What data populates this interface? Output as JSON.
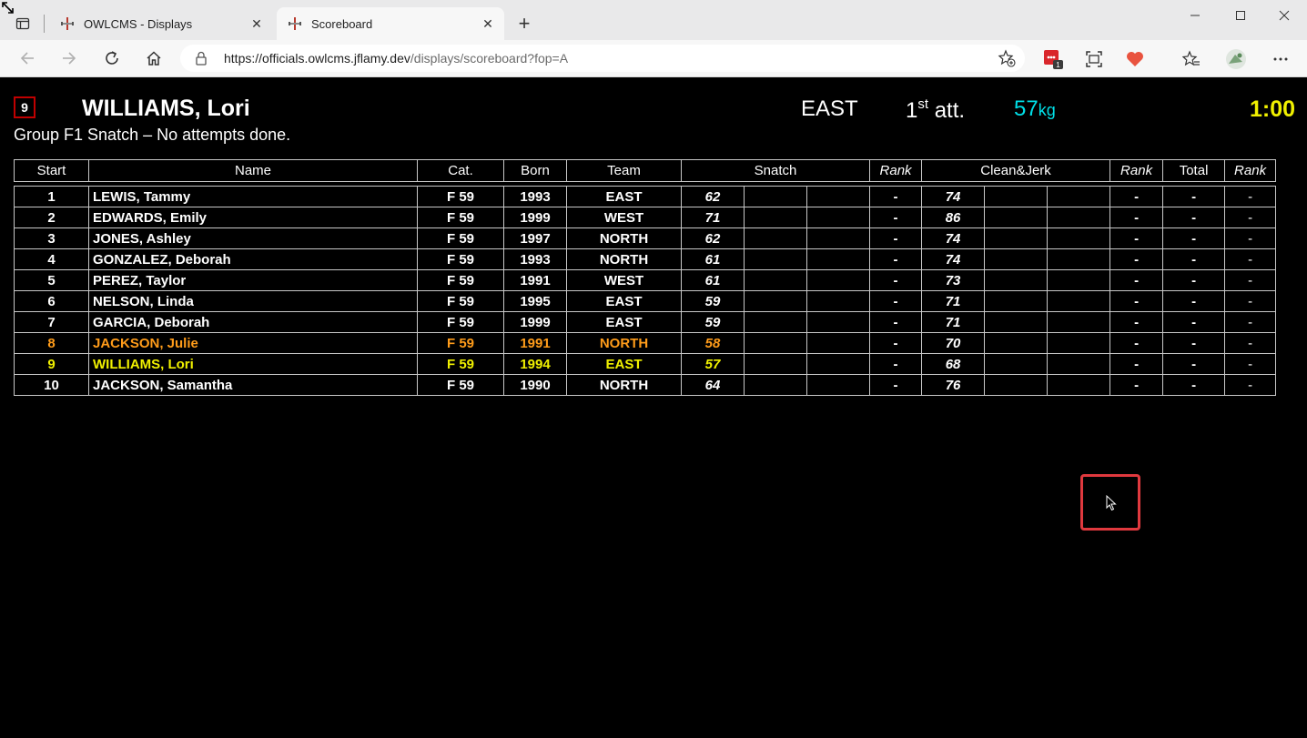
{
  "browser": {
    "tabs": [
      {
        "title": "OWLCMS - Displays",
        "active": false
      },
      {
        "title": "Scoreboard",
        "active": true
      }
    ],
    "url_host": "https://officials.owlcms.jflamy.dev",
    "url_path": "/displays/scoreboard?fop=A",
    "extension_badge": "1"
  },
  "current": {
    "start": "9",
    "name": "WILLIAMS, Lori",
    "team": "EAST",
    "attempt_num": "1",
    "attempt_suffix": "st",
    "attempt_word": "att.",
    "weight": "57",
    "weight_unit": "kg",
    "clock": "1:00",
    "group_info": "Group F1 Snatch – No attempts done."
  },
  "table": {
    "headers": {
      "start": "Start",
      "name": "Name",
      "cat": "Cat.",
      "born": "Born",
      "team": "Team",
      "snatch": "Snatch",
      "rank": "Rank",
      "cj": "Clean&Jerk",
      "rank2": "Rank",
      "total": "Total",
      "rank3": "Rank"
    },
    "rows": [
      {
        "start": "1",
        "name": "LEWIS, Tammy",
        "cat": "F 59",
        "born": "1993",
        "team": "EAST",
        "sn1": "62",
        "sn_rank": "-",
        "cj1": "74",
        "cj_rank": "-",
        "total": "-",
        "total_rank": "-"
      },
      {
        "start": "2",
        "name": "EDWARDS, Emily",
        "cat": "F 59",
        "born": "1999",
        "team": "WEST",
        "sn1": "71",
        "sn_rank": "-",
        "cj1": "86",
        "cj_rank": "-",
        "total": "-",
        "total_rank": "-"
      },
      {
        "start": "3",
        "name": "JONES, Ashley",
        "cat": "F 59",
        "born": "1997",
        "team": "NORTH",
        "sn1": "62",
        "sn_rank": "-",
        "cj1": "74",
        "cj_rank": "-",
        "total": "-",
        "total_rank": "-"
      },
      {
        "start": "4",
        "name": "GONZALEZ, Deborah",
        "cat": "F 59",
        "born": "1993",
        "team": "NORTH",
        "sn1": "61",
        "sn_rank": "-",
        "cj1": "74",
        "cj_rank": "-",
        "total": "-",
        "total_rank": "-"
      },
      {
        "start": "5",
        "name": "PEREZ, Taylor",
        "cat": "F 59",
        "born": "1991",
        "team": "WEST",
        "sn1": "61",
        "sn_rank": "-",
        "cj1": "73",
        "cj_rank": "-",
        "total": "-",
        "total_rank": "-"
      },
      {
        "start": "6",
        "name": "NELSON, Linda",
        "cat": "F 59",
        "born": "1995",
        "team": "EAST",
        "sn1": "59",
        "sn_rank": "-",
        "cj1": "71",
        "cj_rank": "-",
        "total": "-",
        "total_rank": "-"
      },
      {
        "start": "7",
        "name": "GARCIA, Deborah",
        "cat": "F 59",
        "born": "1999",
        "team": "EAST",
        "sn1": "59",
        "sn_rank": "-",
        "cj1": "71",
        "cj_rank": "-",
        "total": "-",
        "total_rank": "-"
      },
      {
        "start": "8",
        "name": "JACKSON, Julie",
        "cat": "F 59",
        "born": "1991",
        "team": "NORTH",
        "sn1": "58",
        "sn_rank": "-",
        "cj1": "70",
        "cj_rank": "-",
        "total": "-",
        "total_rank": "-"
      },
      {
        "start": "9",
        "name": "WILLIAMS, Lori",
        "cat": "F 59",
        "born": "1994",
        "team": "EAST",
        "sn1": "57",
        "sn_rank": "-",
        "cj1": "68",
        "cj_rank": "-",
        "total": "-",
        "total_rank": "-"
      },
      {
        "start": "10",
        "name": "JACKSON, Samantha",
        "cat": "F 59",
        "born": "1990",
        "team": "NORTH",
        "sn1": "64",
        "sn_rank": "-",
        "cj1": "76",
        "cj_rank": "-",
        "total": "-",
        "total_rank": "-"
      }
    ]
  },
  "colors": {
    "current_lifter": "#f0f000",
    "next_lifter": "#ff9c1a",
    "requested_weight": "#00e0e8",
    "start_box_border": "#c00000"
  }
}
